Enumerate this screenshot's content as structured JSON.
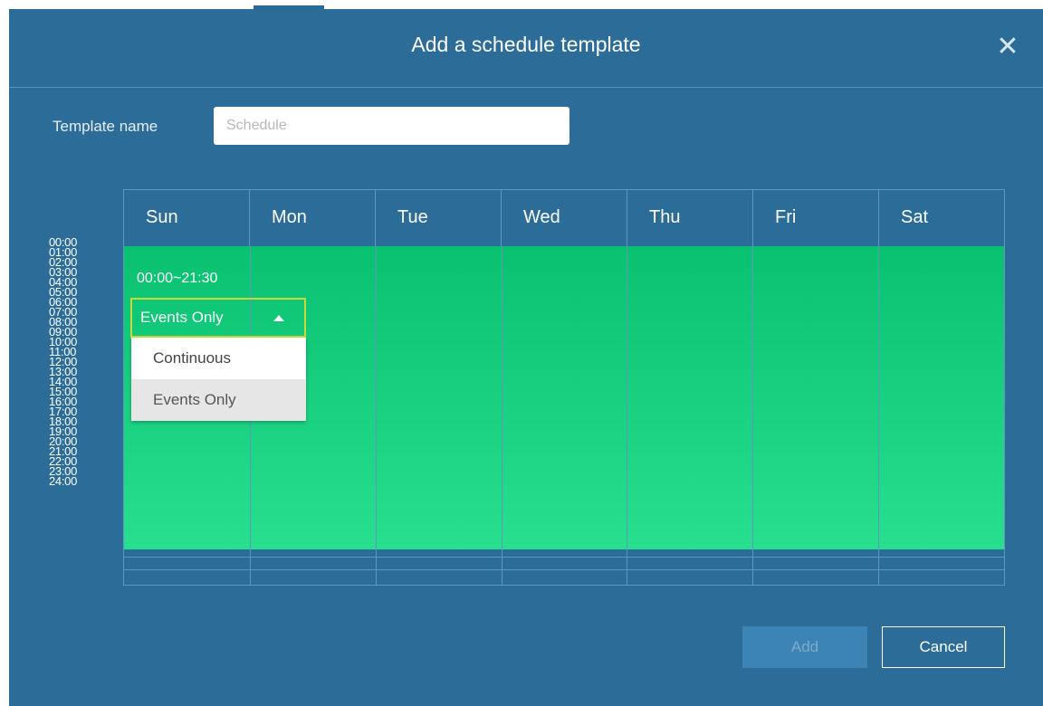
{
  "dialog": {
    "title": "Add a schedule template",
    "close_icon": "close-icon"
  },
  "template_name": {
    "label": "Template name",
    "placeholder": "Schedule",
    "value": ""
  },
  "days": [
    "Sun",
    "Mon",
    "Tue",
    "Wed",
    "Thu",
    "Fri",
    "Sat"
  ],
  "hours": [
    "00:00",
    "01:00",
    "02:00",
    "03:00",
    "04:00",
    "05:00",
    "06:00",
    "07:00",
    "08:00",
    "09:00",
    "10:00",
    "11:00",
    "12:00",
    "13:00",
    "14:00",
    "15:00",
    "16:00",
    "17:00",
    "18:00",
    "19:00",
    "20:00",
    "21:00",
    "22:00",
    "23:00",
    "24:00"
  ],
  "schedule": {
    "range_label": "00:00~21:30",
    "selected_mode": "Events Only",
    "options": [
      "Continuous",
      "Events Only"
    ],
    "block_color": "#1ad27f"
  },
  "footer": {
    "add_label": "Add",
    "cancel_label": "Cancel"
  },
  "colors": {
    "dialog_bg": "#2b6c99",
    "accent_border": "#c7d93c"
  }
}
